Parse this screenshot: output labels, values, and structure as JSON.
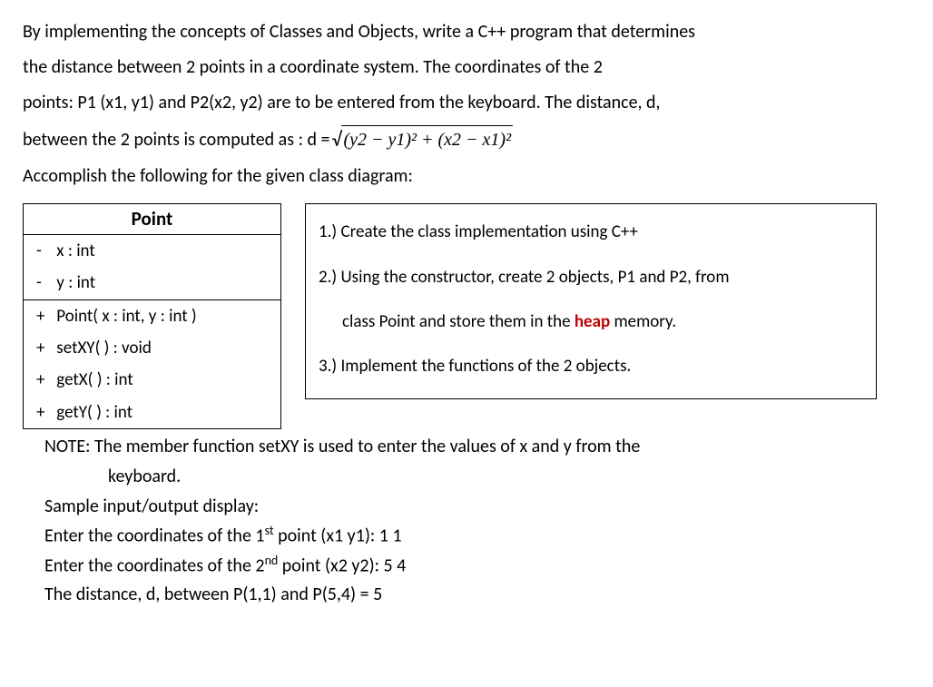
{
  "intro": {
    "p1": "By implementing the concepts of Classes and Objects, write a C++ program that determines",
    "p2": "the distance  between 2 points in a coordinate system.  The coordinates of the 2",
    "p3": "points: P1 (x1, y1) and P2(x2, y2) are to be entered from the keyboard. The distance, d,",
    "p4a": "between the 2 points is computed as :   d = ",
    "sqrt_expr": "(y2 − y1)² + (x2 − x1)²",
    "p5": "Accomplish the following for the given class diagram:"
  },
  "uml": {
    "title": "Point",
    "attrs": [
      {
        "vis": "-",
        "text": "x : int"
      },
      {
        "vis": "-",
        "text": " y : int"
      }
    ],
    "ops": [
      {
        "vis": "+",
        "text": "Point( x : int, y : int )"
      },
      {
        "vis": "+",
        "text": "setXY( ) :  void"
      },
      {
        "vis": "+",
        "text": "getX( ) : int"
      },
      {
        "vis": "+",
        "text": "getY( ) : int"
      }
    ]
  },
  "instructions": {
    "l1": "1.) Create the class implementation using C++",
    "l2": "2.) Using the constructor, create 2 objects, P1 and P2, from",
    "l2b_pre": "class Point and store them in the ",
    "l2b_heap": "heap",
    "l2b_post": " memory.",
    "l3": "3.) Implement the functions of the 2 objects."
  },
  "note": {
    "line1": "NOTE: The member function setXY is used to enter the values of x and y from the",
    "line2": "keyboard."
  },
  "sample": {
    "header": "Sample input/output display:",
    "l1_pre": "Enter the coordinates of the 1",
    "l1_sup": "st",
    "l1_post": " point (x1 y1):  1   1",
    "l2_pre": "Enter the coordinates of the 2",
    "l2_sup": "nd",
    "l2_post": " point (x2  y2): 5   4",
    "l3": "The distance, d,  between P(1,1) and P(5,4)  = 5"
  }
}
